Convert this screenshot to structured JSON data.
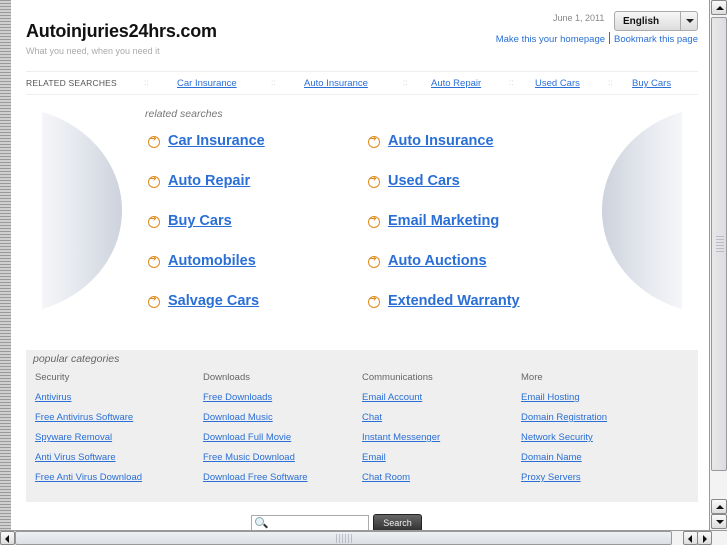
{
  "header": {
    "site_title": "Autoinjuries24hrs.com",
    "tagline": "What you need, when you need it",
    "date": "June 1, 2011",
    "language": "English",
    "links": [
      "Make this your homepage",
      "Bookmark this page"
    ]
  },
  "related_bar": {
    "label": "RELATED SEARCHES",
    "separator": "::",
    "links": [
      "Car Insurance",
      "Auto Insurance",
      "Auto Repair",
      "Used Cars",
      "Buy Cars"
    ]
  },
  "related_searches": {
    "title": "related searches",
    "left": [
      "Car Insurance",
      "Auto Repair",
      "Buy Cars",
      "Automobiles",
      "Salvage Cars"
    ],
    "right": [
      "Auto Insurance",
      "Used Cars",
      "Email Marketing",
      "Auto Auctions",
      "Extended Warranty"
    ],
    "icon": "orange-arrow-circle-icon",
    "accent_color": "#e08a1e",
    "link_color": "#2a6fd6"
  },
  "popular": {
    "title": "popular categories",
    "columns": [
      {
        "heading": "Security",
        "links": [
          "Antivirus",
          "Free Antivirus Software",
          "Spyware Removal",
          "Anti Virus Software",
          "Free Anti Virus Download"
        ]
      },
      {
        "heading": "Downloads",
        "links": [
          "Free Downloads",
          "Download Music",
          "Download Full Movie",
          "Free Music Download",
          "Download Free Software"
        ]
      },
      {
        "heading": "Communications",
        "links": [
          "Email Account",
          "Chat",
          "Instant Messenger",
          "Email",
          "Chat Room"
        ]
      },
      {
        "heading": "More",
        "links": [
          "Email Hosting",
          "Domain Registration",
          "Network Security",
          "Domain Name",
          "Proxy Servers"
        ]
      }
    ]
  },
  "search": {
    "value": "",
    "button_label": "Search"
  }
}
